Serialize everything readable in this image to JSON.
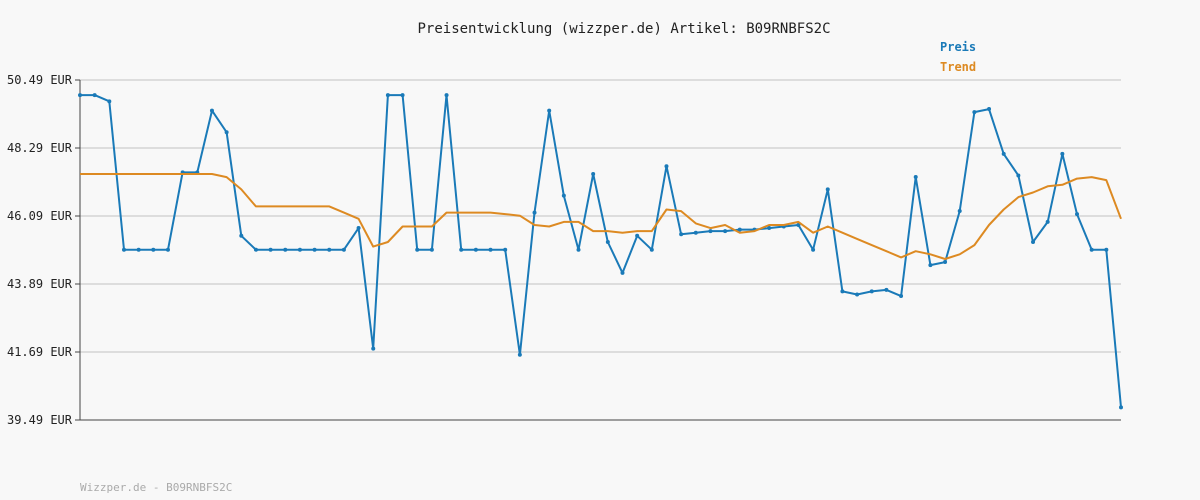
{
  "chart_data": {
    "type": "line",
    "title": "Preisentwicklung (wizzper.de) Artikel: B09RNBFS2C",
    "xlabel": "",
    "ylabel": "",
    "y_ticks": [
      "50.49 EUR",
      "48.29 EUR",
      "46.09 EUR",
      "43.89 EUR",
      "41.69 EUR",
      "39.49 EUR"
    ],
    "ylim": [
      39.49,
      50.49
    ],
    "grid": true,
    "legend_position": "top-right",
    "series": [
      {
        "name": "Preis",
        "color": "#1a7ab8",
        "values": [
          50.0,
          50.0,
          49.8,
          45.0,
          45.0,
          45.0,
          45.0,
          47.5,
          47.5,
          49.5,
          48.8,
          45.45,
          45.0,
          45.0,
          45.0,
          45.0,
          45.0,
          45.0,
          45.0,
          45.7,
          41.8,
          50.0,
          50.0,
          45.0,
          45.0,
          50.0,
          45.0,
          45.0,
          45.0,
          45.0,
          41.6,
          46.2,
          49.5,
          46.75,
          45.0,
          47.45,
          45.25,
          44.25,
          45.45,
          45.0,
          47.7,
          45.5,
          45.55,
          45.6,
          45.6,
          45.65,
          45.65,
          45.7,
          45.75,
          45.8,
          45.0,
          46.95,
          43.65,
          43.55,
          43.65,
          43.7,
          43.5,
          47.35,
          44.5,
          44.6,
          46.25,
          49.45,
          49.55,
          48.1,
          47.4,
          45.25,
          45.9,
          48.1,
          46.15,
          45.0,
          45.0,
          39.9
        ]
      },
      {
        "name": "Trend",
        "color": "#dd8a22",
        "values": [
          47.45,
          47.45,
          47.45,
          47.45,
          47.45,
          47.45,
          47.45,
          47.45,
          47.45,
          47.45,
          47.35,
          46.95,
          46.4,
          46.4,
          46.4,
          46.4,
          46.4,
          46.4,
          46.2,
          46.0,
          45.1,
          45.25,
          45.75,
          45.75,
          45.75,
          46.2,
          46.2,
          46.2,
          46.2,
          46.15,
          46.1,
          45.8,
          45.75,
          45.9,
          45.9,
          45.6,
          45.6,
          45.55,
          45.6,
          45.6,
          46.3,
          46.25,
          45.85,
          45.7,
          45.8,
          45.55,
          45.6,
          45.8,
          45.8,
          45.9,
          45.55,
          45.75,
          45.55,
          45.35,
          45.15,
          44.95,
          44.75,
          44.95,
          44.85,
          44.7,
          44.85,
          45.15,
          45.8,
          46.3,
          46.7,
          46.85,
          47.05,
          47.1,
          47.3,
          47.35,
          47.25,
          46.0
        ]
      }
    ]
  },
  "footer": "Wizzper.de - B09RNBFS2C"
}
